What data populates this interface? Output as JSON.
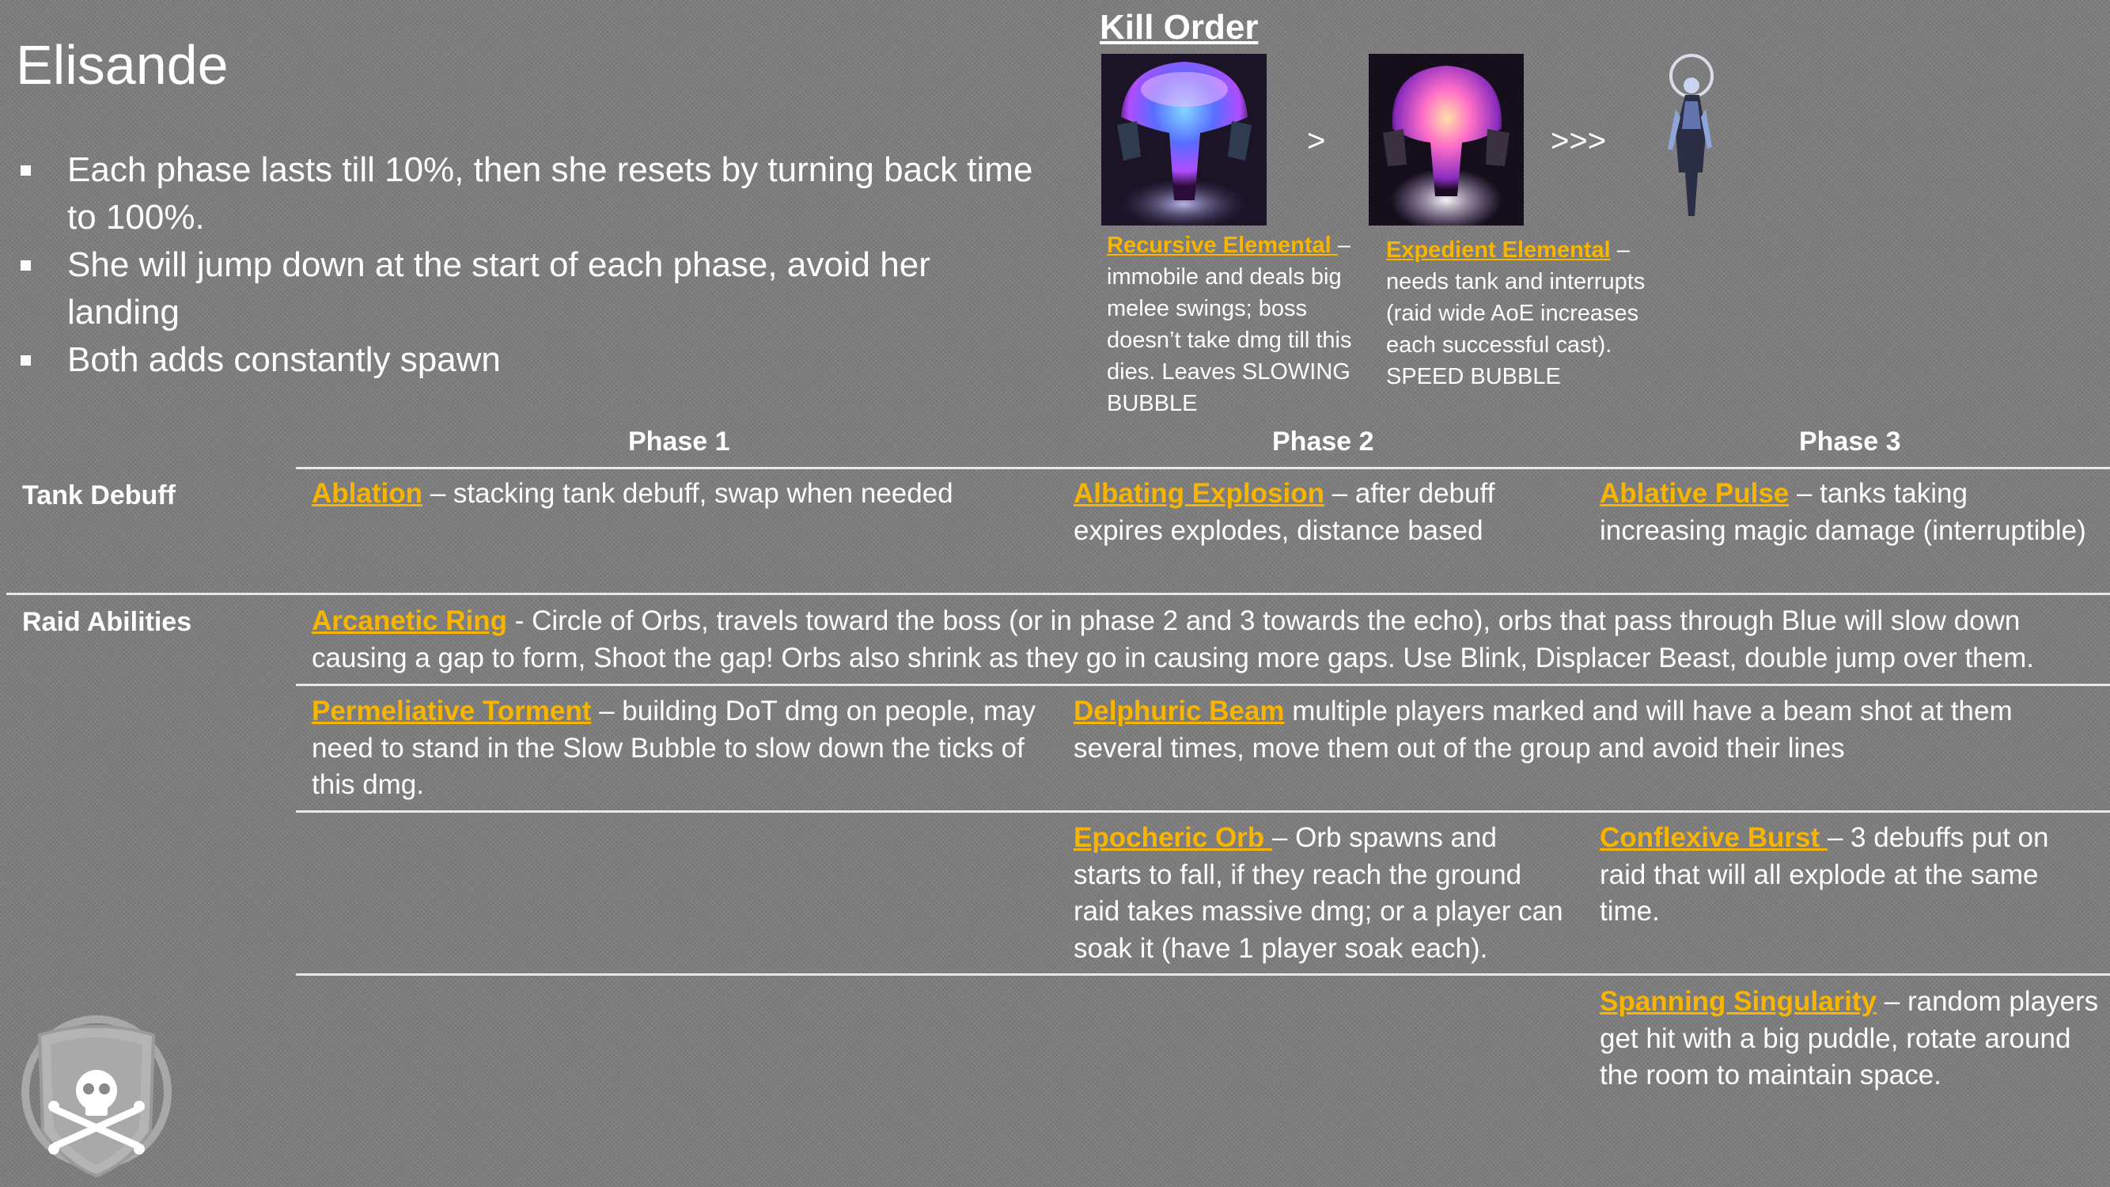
{
  "title": "Elisande",
  "bullets": [
    "Each phase lasts till 10%, then she resets by turning back time to 100%.",
    "She will jump down at the start of each phase, avoid her landing",
    "Both adds constantly spawn"
  ],
  "kill_order": {
    "title": "Kill Order",
    "separator_1": ">",
    "separator_2": ">>>",
    "adds": [
      {
        "name": "Recursive Elemental ",
        "desc": "– immobile and deals big melee swings; boss doesn’t take dmg till this dies.  Leaves SLOWING BUBBLE"
      },
      {
        "name": "Expedient Elemental",
        "desc": " – needs tank and interrupts (raid wide AoE increases each successful cast).  SPEED BUBBLE"
      }
    ]
  },
  "table": {
    "phase_headers": [
      "Phase 1",
      "Phase 2",
      "Phase 3"
    ],
    "tank_label": "Tank Debuff",
    "raid_label": "Raid Abilities",
    "tank": [
      {
        "name": "Ablation",
        "text": " – stacking tank debuff, swap when needed"
      },
      {
        "name": "Albating Explosion",
        "text": " – after debuff expires explodes, distance based"
      },
      {
        "name": "Ablative Pulse",
        "text": " – tanks taking increasing magic damage (interruptible)"
      }
    ],
    "raid": {
      "arcanetic": {
        "name": "Arcanetic Ring",
        "text": " - Circle of Orbs, travels toward the boss (or in phase 2 and 3 towards the echo), orbs that pass through Blue will slow down causing a gap to form, Shoot the gap! Orbs also shrink as they go in causing more gaps.  Use Blink, Displacer Beast, double jump over them."
      },
      "permeliative": {
        "name": "Permeliative Torment",
        "text": " – building DoT dmg on people, may need to stand in the Slow Bubble to slow down the ticks of this dmg."
      },
      "delphuric": {
        "name": "Delphuric Beam",
        "text": " multiple players marked and will have a beam shot at them several times, move them out of the group and avoid their lines"
      },
      "epocheric": {
        "name": "Epocheric Orb ",
        "text": "– Orb spawns and starts to fall, if they reach the ground raid takes massive dmg; or a player can soak it (have 1 player soak each)."
      },
      "conflexive": {
        "name": "Conflexive Burst ",
        "text": "– 3 debuffs put on raid that will all explode at the same time."
      },
      "spanning": {
        "name": "Spanning Singularity",
        "text": " – random players get hit with a big puddle, rotate around the room to maintain space."
      }
    }
  },
  "colors": {
    "background": "#7d7d7d",
    "ability_name": "#f7b500",
    "text": "#ffffff"
  },
  "icons": [
    "recursive-elemental-portrait",
    "expedient-elemental-portrait",
    "elisande-portrait",
    "guild-crest-skull-icon"
  ]
}
